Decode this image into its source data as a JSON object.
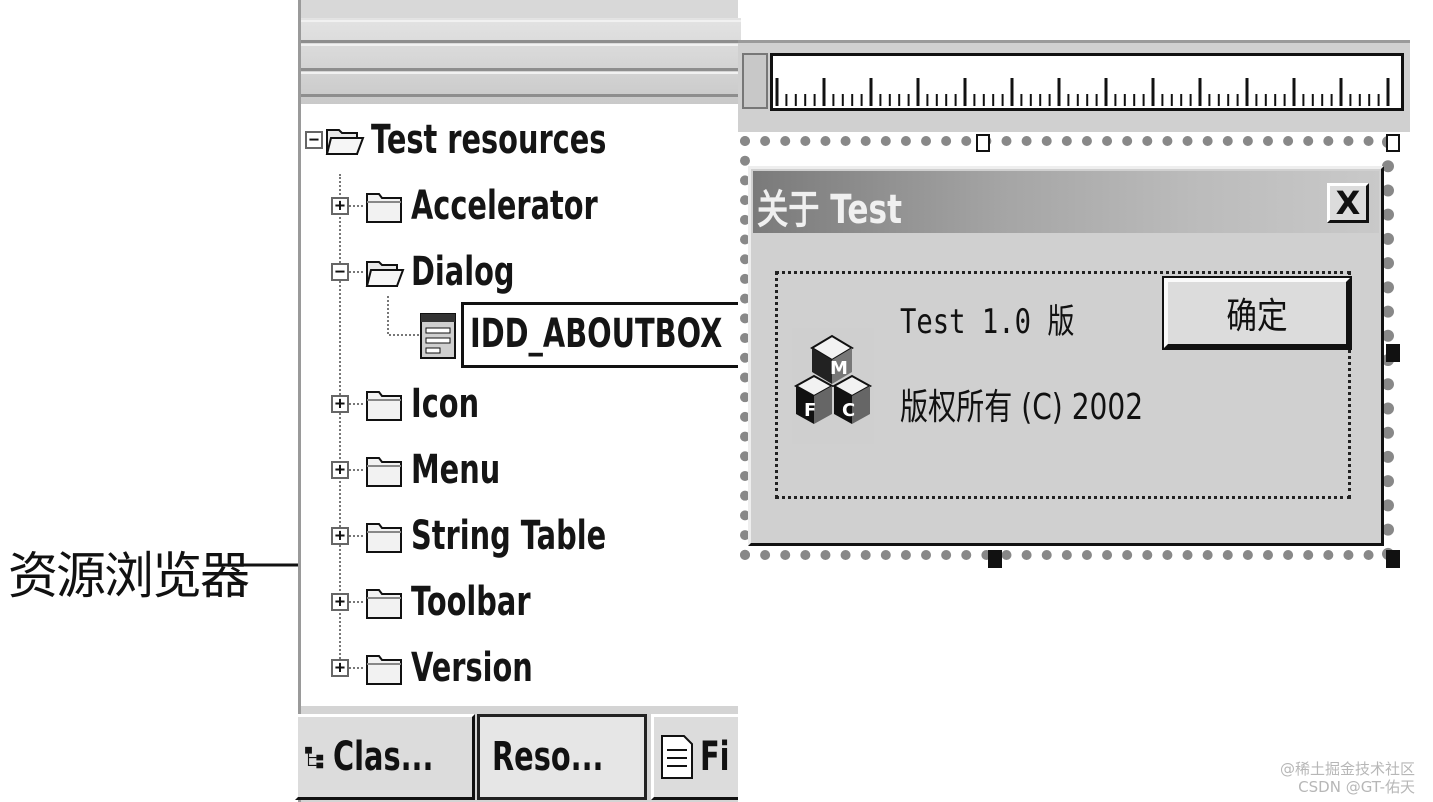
{
  "annotation": {
    "label": "资源浏览器"
  },
  "resource_view": {
    "root": {
      "label": "Test resources",
      "expanded": true,
      "icon": "open-folder-icon"
    },
    "items": [
      {
        "label": "Accelerator",
        "expander": "+"
      },
      {
        "label": "Dialog",
        "expander": "−",
        "children": [
          {
            "label": "IDD_ABOUTBOX",
            "icon": "dialog-resource-icon"
          }
        ]
      },
      {
        "label": "Icon",
        "expander": "+"
      },
      {
        "label": "Menu",
        "expander": "+"
      },
      {
        "label": "String Table",
        "expander": "+"
      },
      {
        "label": "Toolbar",
        "expander": "+"
      },
      {
        "label": "Version",
        "expander": "+"
      }
    ],
    "tabs": [
      {
        "label": "Clas...",
        "icon": "class-view-icon"
      },
      {
        "label": "Reso...",
        "icon": "resource-view-icon",
        "active": true
      },
      {
        "label": "Fi",
        "icon": "file-view-icon"
      }
    ]
  },
  "dialog_preview": {
    "title": "关于 Test",
    "close_label": "X",
    "version_text": "Test 1.0 版",
    "copyright_text": "版权所有 (C) 2002",
    "ok_label": "确定",
    "logo_icon": "mfc-logo-icon",
    "logo_letters": [
      "M",
      "F",
      "C"
    ]
  },
  "watermarks": [
    "@稀土掘金技术社区",
    "CSDN @GT-佑天"
  ]
}
